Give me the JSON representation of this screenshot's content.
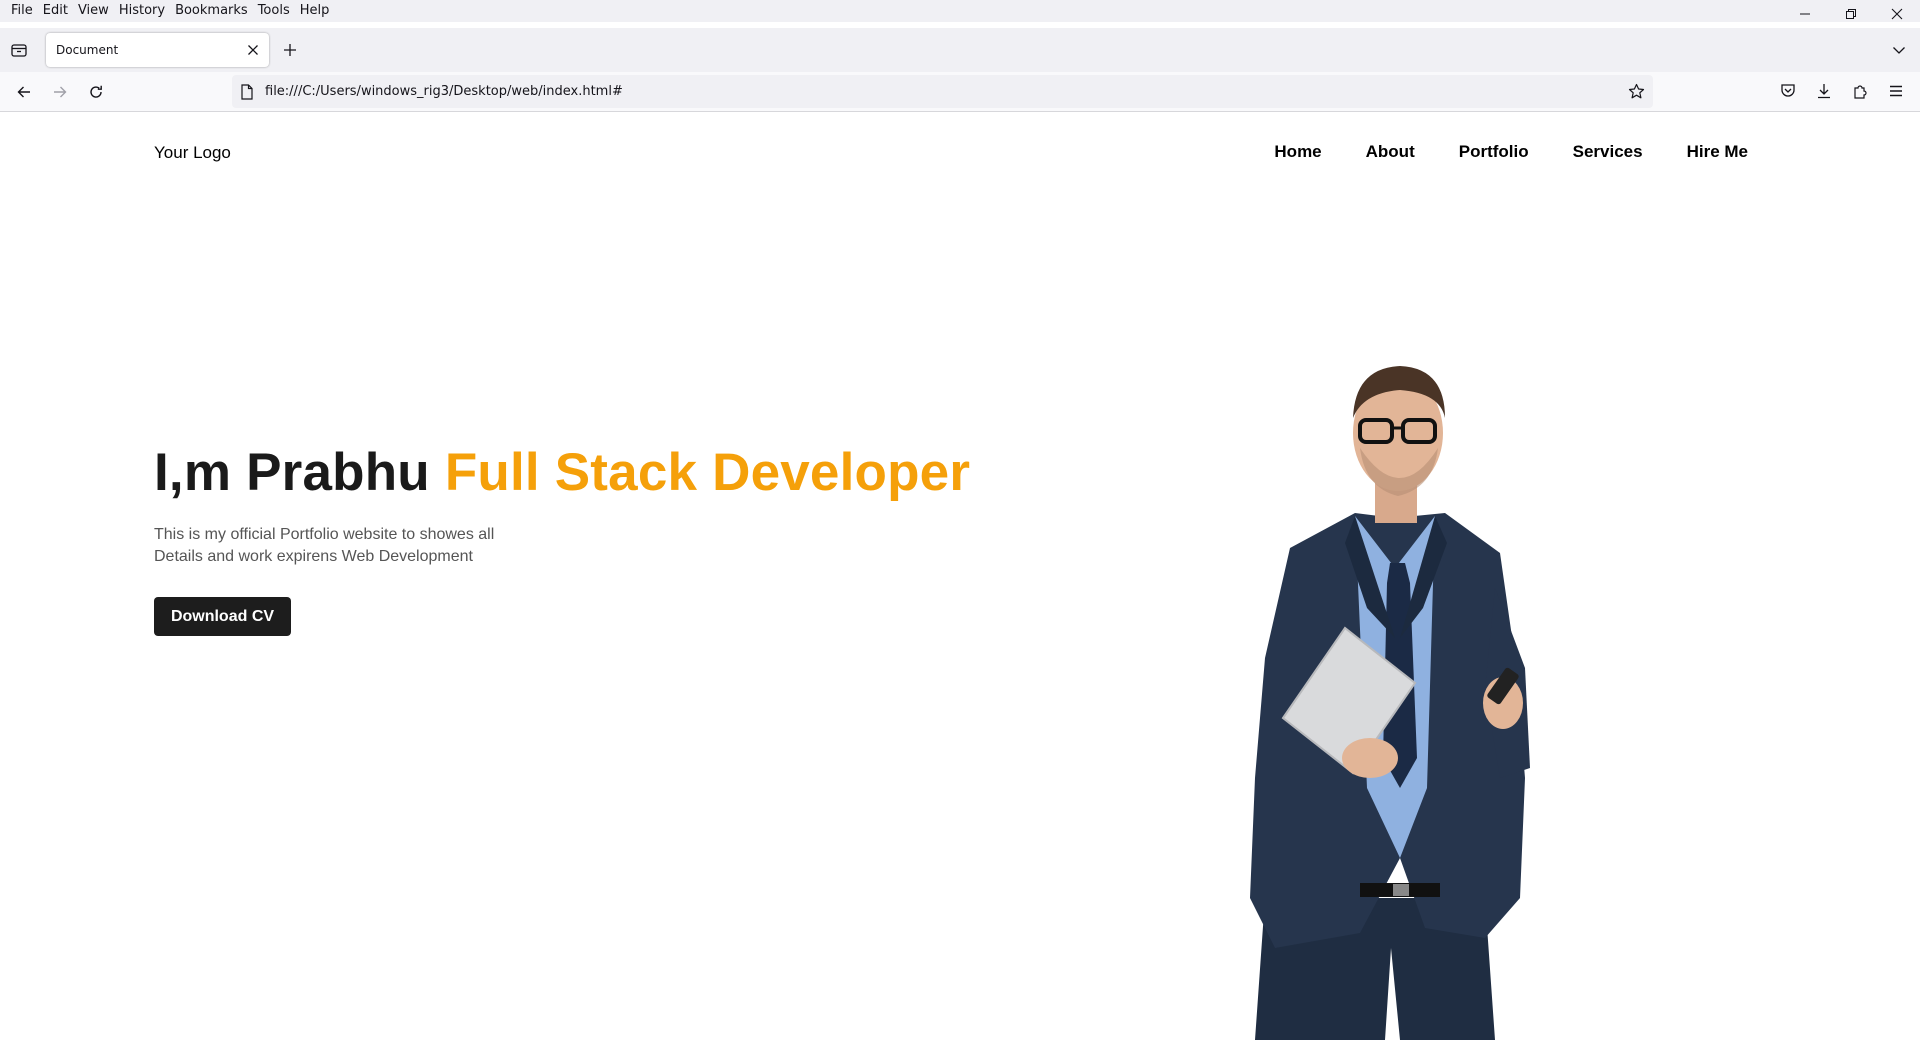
{
  "browser": {
    "menu": [
      {
        "label": "File"
      },
      {
        "label": "Edit"
      },
      {
        "label": "View"
      },
      {
        "label": "History"
      },
      {
        "label": "Bookmarks"
      },
      {
        "label": "Tools"
      },
      {
        "label": "Help"
      }
    ],
    "tab_title": "Document",
    "url": "file:///C:/Users/windows_rig3/Desktop/web/index.html#",
    "icons": {
      "back": "arrow-left-icon",
      "forward": "arrow-right-icon",
      "reload": "reload-icon",
      "page": "page-icon",
      "bookmark": "star-icon",
      "pocket": "pocket-icon",
      "downloads": "download-icon",
      "extensions": "puzzle-icon",
      "menu": "hamburger-icon"
    }
  },
  "site": {
    "logo": "Your Logo",
    "nav": [
      "Home",
      "About",
      "Portfolio",
      "Services",
      "Hire Me"
    ],
    "hero": {
      "title_main": "I,m Prabhu ",
      "title_accent": "Full Stack Developer",
      "desc_line1": "This is my official Portfolio website to showes all",
      "desc_line2": "Details and work expirens Web Development",
      "button": "Download CV"
    },
    "colors": {
      "accent": "#f5a00a",
      "button_bg": "#1d1d1d"
    }
  }
}
